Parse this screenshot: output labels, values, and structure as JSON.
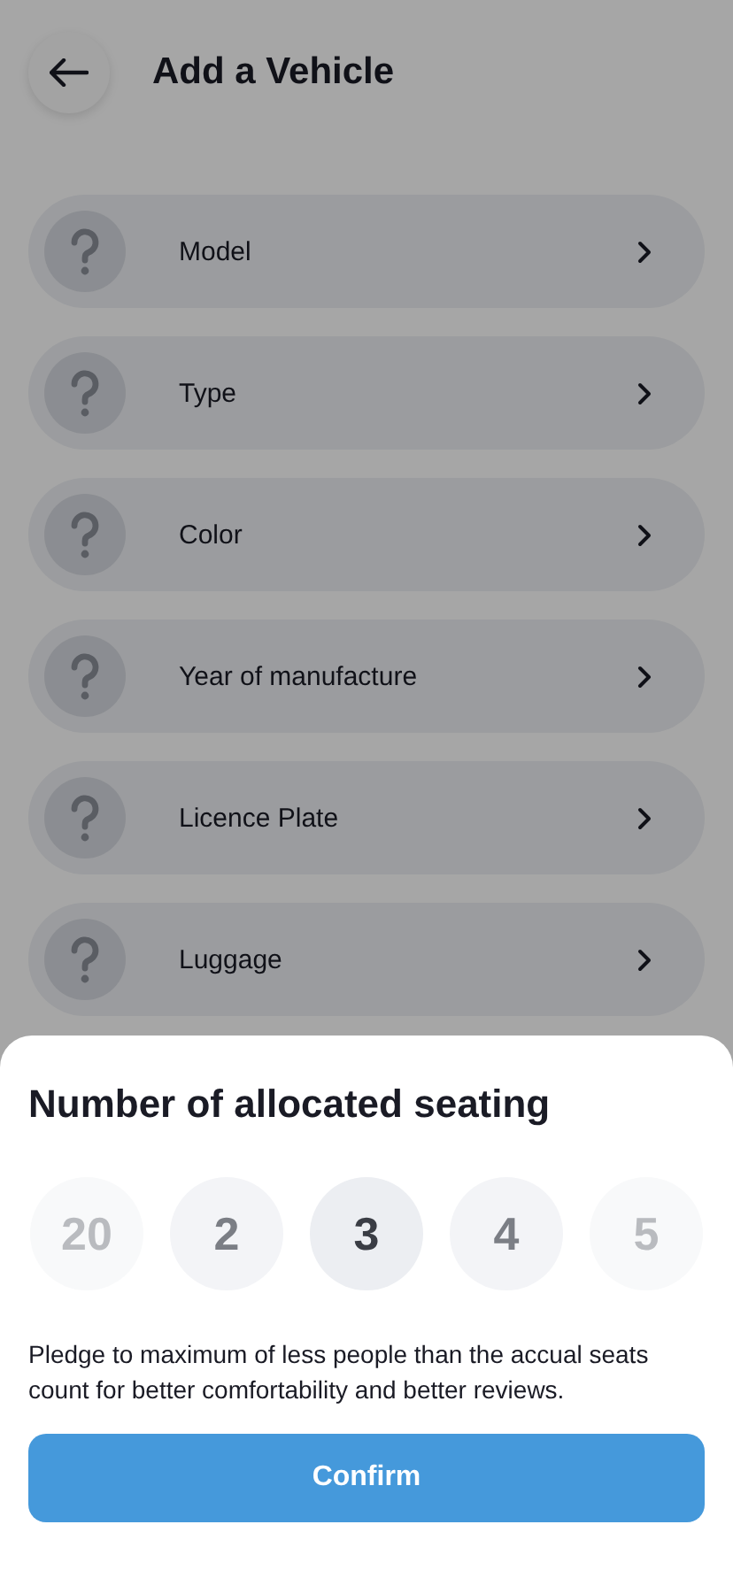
{
  "header": {
    "title": "Add a Vehicle"
  },
  "fields": [
    {
      "label": "Model"
    },
    {
      "label": "Type"
    },
    {
      "label": "Color"
    },
    {
      "label": "Year of manufacture"
    },
    {
      "label": "Licence Plate"
    },
    {
      "label": "Luggage"
    }
  ],
  "sheet": {
    "title": "Number of allocated seating",
    "options": [
      {
        "label": "20",
        "selected": false
      },
      {
        "label": "2",
        "selected": false
      },
      {
        "label": "3",
        "selected": true
      },
      {
        "label": "4",
        "selected": false
      },
      {
        "label": "5",
        "selected": false
      }
    ],
    "note": "Pledge to maximum of less people than the accual seats count for better comfortability and better reviews.",
    "confirm": "Confirm"
  }
}
